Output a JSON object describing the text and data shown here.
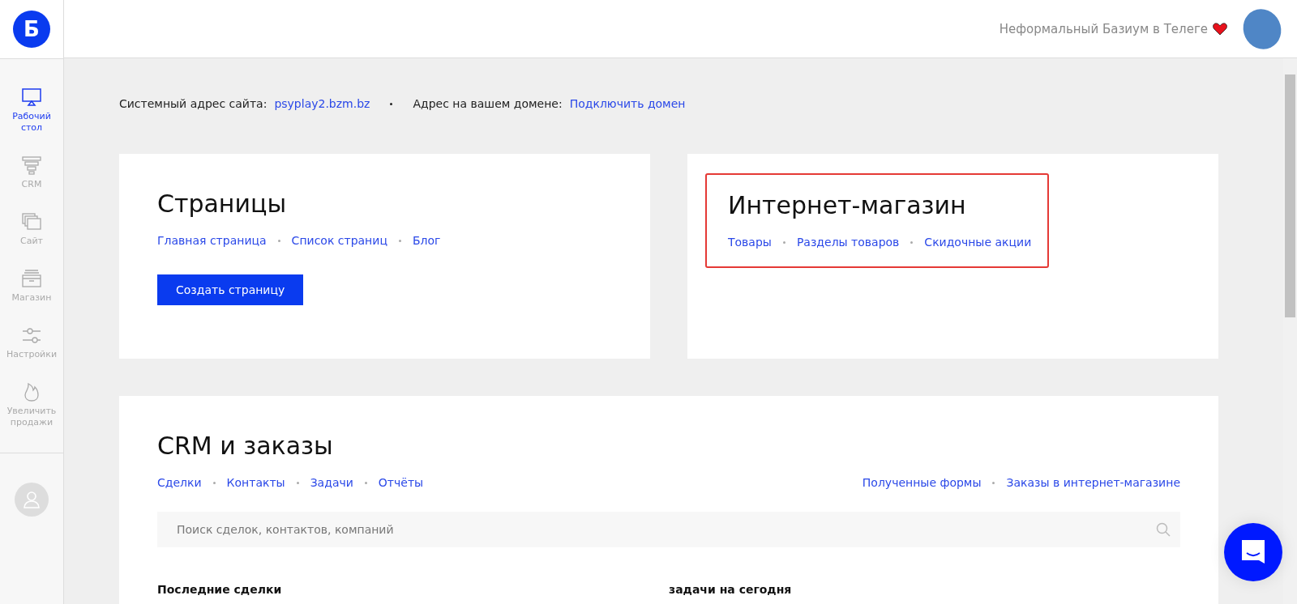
{
  "sidebar": {
    "items": [
      {
        "label": "Рабочий стол",
        "selected": true
      },
      {
        "label": "CRM",
        "selected": false
      },
      {
        "label": "Сайт",
        "selected": false
      },
      {
        "label": "Магазин",
        "selected": false
      },
      {
        "label": "Настройки",
        "selected": false
      },
      {
        "label": "Увеличить продажи",
        "selected": false
      }
    ]
  },
  "header": {
    "logo": "Б",
    "telegram_link": "Неформальный Базиум в Телеге"
  },
  "address_bar": {
    "system_label": "Системный адрес сайта:",
    "system_url": "psyplay2.bzm.bz",
    "domain_label": "Адрес на вашем домене:",
    "domain_link": "Подключить домен"
  },
  "pages_card": {
    "title": "Страницы",
    "links": [
      "Главная страница",
      "Список страниц",
      "Блог"
    ],
    "button": "Создать страницу"
  },
  "shop_card": {
    "title": "Интернет-магазин",
    "highlighted": true,
    "links": [
      "Товары",
      "Разделы товаров",
      "Скидочные акции"
    ]
  },
  "crm_card": {
    "title": "CRM и заказы",
    "links": [
      "Сделки",
      "Контакты",
      "Задачи",
      "Отчёты"
    ],
    "right_links": [
      "Полученные формы",
      "Заказы в интернет-магазине"
    ],
    "search": {
      "placeholder": "Поиск сделок, контактов, компаний"
    },
    "sections": [
      "Последние сделки",
      "задачи на сегодня"
    ]
  }
}
